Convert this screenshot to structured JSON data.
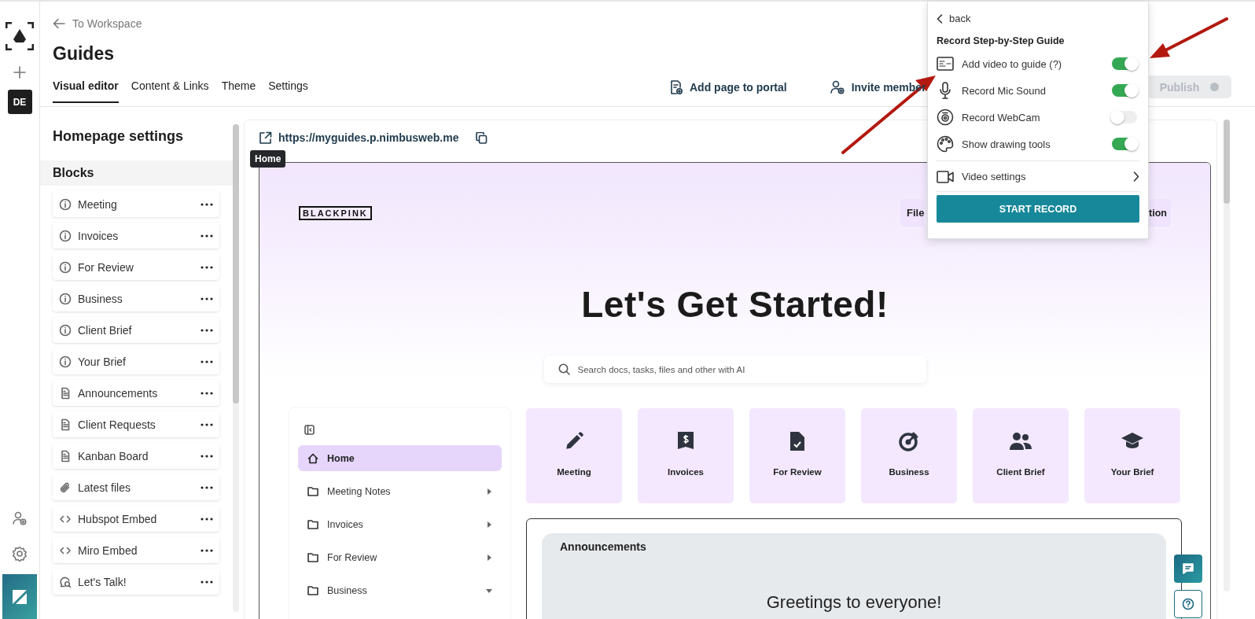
{
  "rail": {
    "avatar": "DE"
  },
  "header": {
    "back_link": "To Workspace",
    "title": "Guides",
    "tabs": [
      {
        "label": "Visual editor",
        "selected": true
      },
      {
        "label": "Content & Links",
        "selected": false
      },
      {
        "label": "Theme",
        "selected": false
      },
      {
        "label": "Settings",
        "selected": false
      }
    ],
    "actions": [
      {
        "label": "Add page to portal",
        "kind": "page"
      },
      {
        "label": "Invite member",
        "kind": "invite"
      }
    ],
    "publish": {
      "label": "Publish",
      "disabled": true
    }
  },
  "settings_panel": {
    "title": "Homepage settings",
    "section": "Blocks",
    "blocks": [
      {
        "label": "Meeting",
        "kind": "info"
      },
      {
        "label": "Invoices",
        "kind": "info"
      },
      {
        "label": "For Review",
        "kind": "info"
      },
      {
        "label": "Business",
        "kind": "info"
      },
      {
        "label": "Client Brief",
        "kind": "info"
      },
      {
        "label": "Your Brief",
        "kind": "info"
      },
      {
        "label": "Announcements",
        "kind": "doc"
      },
      {
        "label": "Client Requests",
        "kind": "doc"
      },
      {
        "label": "Kanban Board",
        "kind": "doc"
      },
      {
        "label": "Latest files",
        "kind": "clip"
      },
      {
        "label": "Hubspot Embed",
        "kind": "code"
      },
      {
        "label": "Miro Embed",
        "kind": "code"
      },
      {
        "label": "Let's Talk!",
        "kind": "chat"
      }
    ]
  },
  "preview": {
    "url": "https://myguides.p.nimbusweb.me",
    "tooltip": "Home",
    "site": {
      "logo": "BLACKPINK",
      "nav": [
        "File",
        "tion"
      ],
      "heading": "Let's Get Started!",
      "search": {
        "placeholder": "Search docs, tasks, files and other with AI"
      },
      "sidebar": [
        {
          "label": "Home",
          "kind": "home",
          "selected": true
        },
        {
          "label": "Meeting Notes",
          "kind": "folder",
          "selected": false,
          "expanded": false
        },
        {
          "label": "Invoices",
          "kind": "folder",
          "selected": false,
          "expanded": false
        },
        {
          "label": "For Review",
          "kind": "folder",
          "selected": false,
          "expanded": false
        },
        {
          "label": "Business",
          "kind": "folder",
          "selected": false,
          "expanded": true
        }
      ],
      "tiles": [
        {
          "label": "Meeting",
          "kind": "pencil"
        },
        {
          "label": "Invoices",
          "kind": "money"
        },
        {
          "label": "For Review",
          "kind": "filecheck"
        },
        {
          "label": "Business",
          "kind": "target"
        },
        {
          "label": "Client Brief",
          "kind": "users"
        },
        {
          "label": "Your Brief",
          "kind": "cap"
        }
      ],
      "announcements": {
        "title": "Announcements",
        "greeting": "Greetings to everyone!"
      }
    }
  },
  "record_popup": {
    "back": "back",
    "title": "Record Step-by-Step Guide",
    "options": [
      {
        "label": "Add video to guide (?)",
        "kind": "card",
        "on": true
      },
      {
        "label": "Record Mic Sound",
        "kind": "mic",
        "on": true
      },
      {
        "label": "Record WebCam",
        "kind": "webcam",
        "on": false
      },
      {
        "label": "Show drawing tools",
        "kind": "palette",
        "on": true
      }
    ],
    "video_settings": "Video settings",
    "start_button": "START RECORD"
  }
}
